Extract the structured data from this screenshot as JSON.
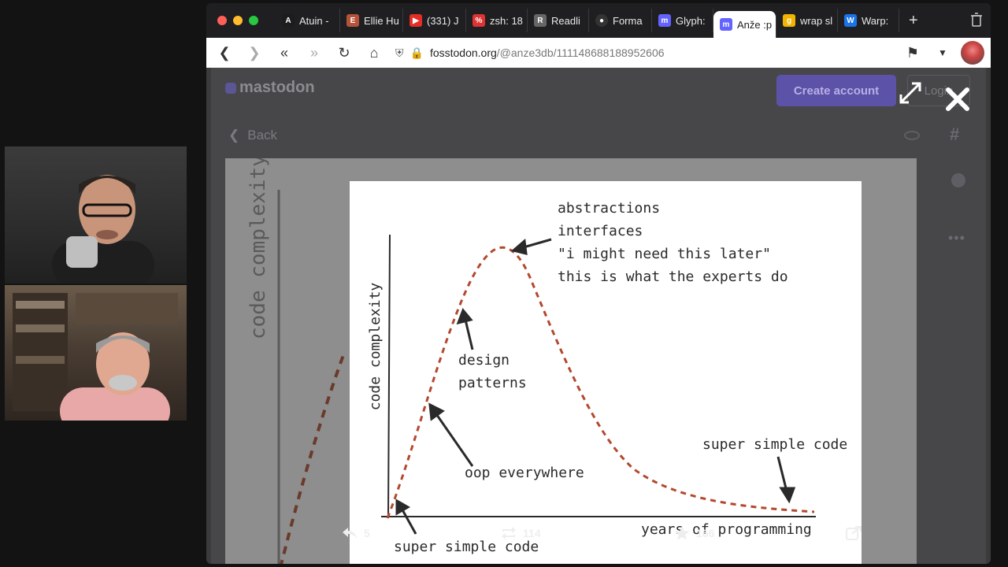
{
  "tabs": [
    {
      "label": "Atuin -",
      "icon": "atuin-icon",
      "color": "#1c1c1c"
    },
    {
      "label": "Ellie Hu",
      "icon": "ellie-icon",
      "color": "#b5533a"
    },
    {
      "label": "(331) J",
      "icon": "youtube-icon",
      "color": "#e52d27"
    },
    {
      "label": "zsh: 18",
      "icon": "zsh-icon",
      "color": "#d33"
    },
    {
      "label": "Readli",
      "icon": "readline-icon",
      "color": "#666"
    },
    {
      "label": "Forma",
      "icon": "github-icon",
      "color": "#333"
    },
    {
      "label": "Glyph:",
      "icon": "mastodon-icon",
      "color": "#6364ff"
    },
    {
      "label": "Anže :p",
      "icon": "mastodon-icon",
      "color": "#6364ff"
    },
    {
      "label": "wrap sl",
      "icon": "g-icon",
      "color": "#f2b400"
    },
    {
      "label": "Warp: ",
      "icon": "warp-icon",
      "color": "#1a73e8"
    }
  ],
  "url": {
    "domain": "fosstodon.org",
    "path": "/@anze3db/111148688188952606"
  },
  "site": {
    "logo": "mastodon",
    "create_account": "Create account",
    "login": "Login",
    "back": "Back"
  },
  "chart_data": {
    "type": "line",
    "xlabel": "years of programming",
    "ylabel": "code complexity",
    "annotations": [
      "abstractions",
      "interfaces",
      "\"i might need this later\"",
      "this is what the experts do",
      "design",
      "patterns",
      "oop everywhere",
      "super simple code",
      "super simple code"
    ]
  },
  "post": {
    "replies": "5",
    "boosts": "114",
    "favourites": "166"
  }
}
